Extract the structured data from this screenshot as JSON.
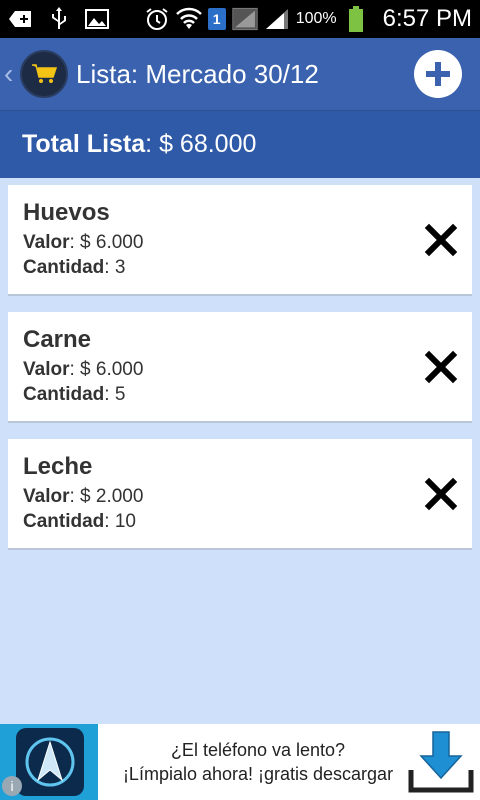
{
  "status_bar": {
    "battery_percent": "100%",
    "time": "6:57 PM",
    "notification_count": "1"
  },
  "action_bar": {
    "back_chevron": "‹",
    "title": "Lista: Mercado 30/12"
  },
  "total": {
    "label": "Total Lista",
    "separator": ": ",
    "value": "$ 68.000"
  },
  "items": [
    {
      "name": "Huevos",
      "valor_label": "Valor",
      "valor": ": $ 6.000",
      "cantidad_label": "Cantidad",
      "cantidad": ": 3"
    },
    {
      "name": "Carne",
      "valor_label": "Valor",
      "valor": ": $ 6.000",
      "cantidad_label": "Cantidad",
      "cantidad": ": 5"
    },
    {
      "name": "Leche",
      "valor_label": "Valor",
      "valor": ": $ 2.000",
      "cantidad_label": "Cantidad",
      "cantidad": ": 10"
    }
  ],
  "ad": {
    "line1": "¿El teléfono va lento?",
    "line2": "¡Límpialo ahora! ¡gratis descargar",
    "info_glyph": "i"
  },
  "colors": {
    "action_bar": "#3b62ae",
    "total_bar": "#2f5aa8",
    "background": "#cfe0fb"
  }
}
